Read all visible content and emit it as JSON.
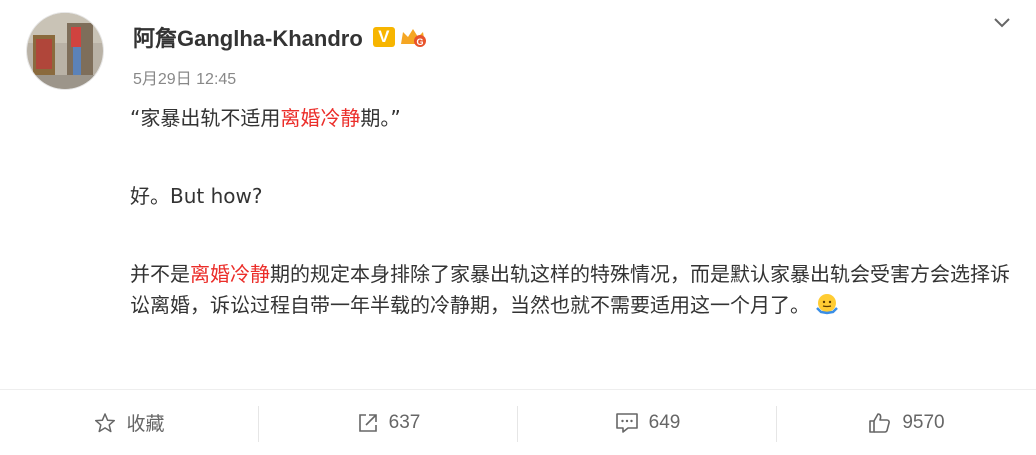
{
  "post": {
    "username": "阿詹Ganglha-Khandro",
    "verified_badge": "V",
    "timestamp": "5月29日 12:45",
    "para1": {
      "before": "“家暴出轨不适用",
      "tag": "离婚冷静",
      "after": "期。”"
    },
    "para2": "好。But how?",
    "para3": {
      "before": "并不是",
      "tag": "离婚冷静",
      "after": "期的规定本身排除了家暴出轨这样的特殊情况，而是默认家暴出轨会受害方会选择诉讼离婚，诉讼过程自带一年半载的冷静期，当然也就不需要适用这一个月了。"
    },
    "tag_color": "#eb2d29"
  },
  "actions": {
    "favorite_label": "收藏",
    "repost_count": "637",
    "comment_count": "649",
    "like_count": "9570"
  },
  "icons": [
    "avatar",
    "verified-v-badge",
    "crown-badge-icon",
    "chevron-down-icon",
    "shrug-emoji-icon",
    "star-icon",
    "repost-icon",
    "comment-icon",
    "thumbs-up-icon"
  ]
}
